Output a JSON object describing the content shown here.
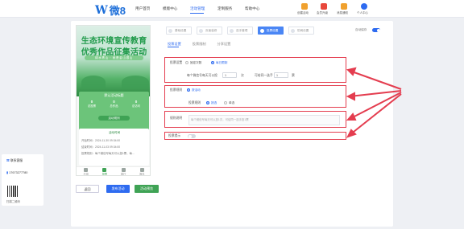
{
  "brand": {
    "logo_w": "W",
    "logo_text": "微8"
  },
  "nav": {
    "items": [
      {
        "label": "用户首页"
      },
      {
        "label": "模版中心"
      },
      {
        "label": "活动管理"
      },
      {
        "label": "定制服务"
      },
      {
        "label": "帮助中心"
      }
    ],
    "active_index": 2,
    "right": [
      {
        "label": "创建活动",
        "icon": "create-activity-icon",
        "color": "#f0a12e"
      },
      {
        "label": "会员升级",
        "icon": "member-upgrade-icon",
        "color": "#e8483b"
      },
      {
        "label": "消息通知",
        "icon": "notification-icon",
        "color": "#f0a12e"
      },
      {
        "label": "个人中心",
        "icon": "user-icon",
        "color": "#2e6bf0"
      }
    ]
  },
  "preview": {
    "title_line1": "生态环境宣传教育",
    "title_line2": "优秀作品征集活动",
    "subtitle": "绿水青山 · 就是金山银山",
    "panel_title": "默认活动标题",
    "stats": [
      {
        "value": "0",
        "label": "总投票"
      },
      {
        "value": "0",
        "label": "总作品"
      },
      {
        "value": "0",
        "label": "总访问"
      }
    ],
    "rules_pill": "活动规则",
    "rules_head": "活动时间",
    "rule_lines": [
      "开始时间：2024-11-30 09:34:00",
      "结束时间：2024-11-03 09:34:00",
      "投票规则：每个微信号每天可以投1票，每..."
    ],
    "tabs": [
      {
        "label": "介绍",
        "active": false
      },
      {
        "label": "投票",
        "active": true
      },
      {
        "label": "排行",
        "active": false
      },
      {
        "label": "报名",
        "active": false
      }
    ]
  },
  "buttons": {
    "cancel": "返回",
    "publish": "发布活动",
    "preview": "活动预览"
  },
  "steps": [
    {
      "label": "基础设置",
      "active": false
    },
    {
      "label": "页面装修",
      "active": false
    },
    {
      "label": "选手管理",
      "active": false
    },
    {
      "label": "投票设置",
      "active": true
    },
    {
      "label": "防刷设置",
      "active": false
    }
  ],
  "global_toggle": {
    "label": "自动保存",
    "on": true
  },
  "subtabs": [
    {
      "label": "投票设置",
      "active": true
    },
    {
      "label": "投票限制",
      "active": false
    },
    {
      "label": "分享设置",
      "active": false
    }
  ],
  "vote_limit": {
    "label": "投票设置",
    "options": [
      {
        "label": "固定次数",
        "on": false
      },
      {
        "label": "每日限制",
        "on": true
      }
    ],
    "prefix": "每个微信号每天可以投",
    "votes_value": "1",
    "votes_unit": "次",
    "mid": "可给同一选手",
    "same_value": "1",
    "same_unit": "票"
  },
  "vote_scope": {
    "label": "投票规则",
    "top_option": {
      "label": "按活动",
      "on": true
    },
    "sub_label": "投票规则",
    "options": [
      {
        "label": "按选",
        "on": true
      },
      {
        "label": "单选",
        "on": false
      }
    ]
  },
  "vote_desc": {
    "label": "规则说明",
    "placeholder": "每个微信号每天可以投1次，可给同一选手投1票"
  },
  "vote_tip": {
    "label": "投票提示",
    "on": false
  },
  "contact": {
    "service_label": "联系客服",
    "phone": "17673277780",
    "qr_label": "扫描二维码"
  }
}
